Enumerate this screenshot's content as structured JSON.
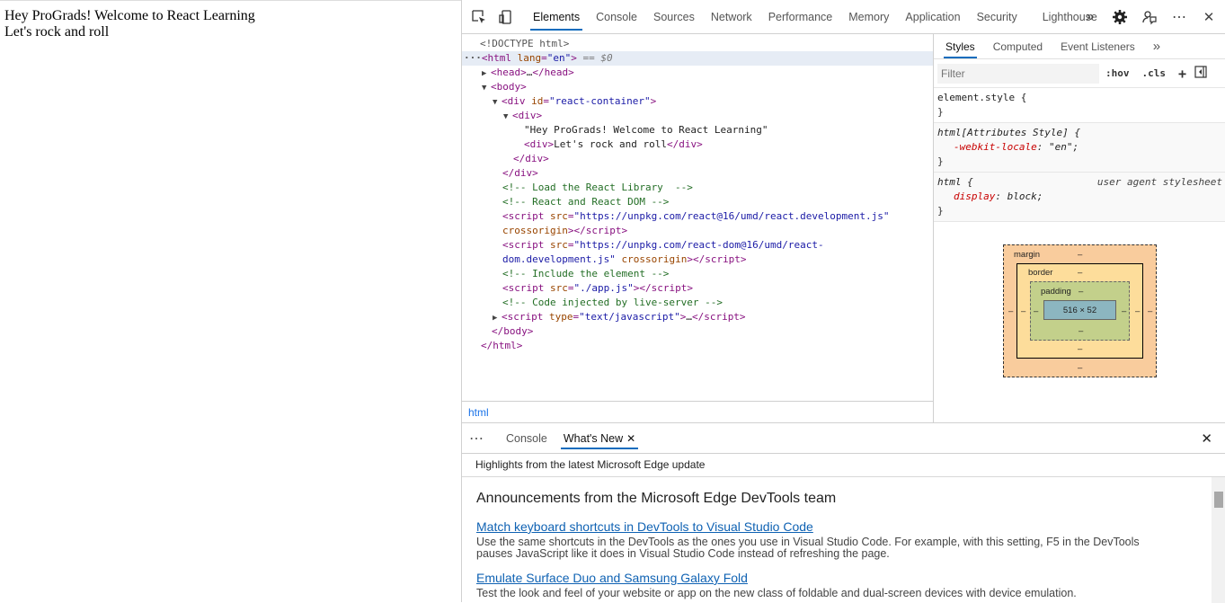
{
  "page": {
    "line1": "Hey ProGrads! Welcome to React Learning",
    "line2": "Let's rock and roll"
  },
  "devtools": {
    "tabs": [
      "Elements",
      "Console",
      "Sources",
      "Network",
      "Performance",
      "Memory",
      "Application",
      "Security",
      "Lighthouse"
    ],
    "active_tab": "Elements",
    "icons": {
      "inspect": "inspect-icon",
      "device": "device-toolbar-icon",
      "more_tabs": "»",
      "settings": "gear-icon",
      "feedback": "feedback-icon",
      "menu": "⋯",
      "close": "✕"
    }
  },
  "elements": {
    "doctype": "<!DOCTYPE html>",
    "html_lang_attr": "lang",
    "html_lang_val": "\"en\"",
    "selected_marker": "== $0",
    "head_collapsed": "…",
    "container_id": "\"react-container\"",
    "text_node": "\"Hey ProGrads! Welcome to React Learning\"",
    "inner_div_text": "Let's rock and roll",
    "comment1": "<!-- Load the React Library  -->",
    "comment2": "<!-- React and React DOM -->",
    "script1_src": "\"https://unpkg.com/react@16/umd/react.development.js\"",
    "script1_cont": "crossorigin",
    "script2_src": "\"https://unpkg.com/react-dom@16/umd/react-",
    "script2_src_cont": "dom.development.js\"",
    "script2_attr": "crossorigin",
    "comment3": "<!-- Include the element -->",
    "script3_src": "\"./app.js\"",
    "comment4": "<!-- Code injected by live-server -->",
    "script4_type": "\"text/javascript\"",
    "breadcrumb": "html"
  },
  "styles": {
    "tabs": [
      "Styles",
      "Computed",
      "Event Listeners"
    ],
    "more": "»",
    "filter_placeholder": "Filter",
    "hov": ":hov",
    "cls": ".cls",
    "plus": "+",
    "rule1_selector": "element.style {",
    "close_brace": "}",
    "rule2_selector": "html[Attributes Style] {",
    "rule2_prop": "-webkit-locale",
    "rule2_val": "\"en\";",
    "rule3_selector": "html {",
    "rule3_source": "user agent stylesheet",
    "rule3_prop": "display",
    "rule3_val": "block;"
  },
  "boxmodel": {
    "margin_label": "margin",
    "border_label": "border",
    "padding_label": "padding",
    "dash": "–",
    "content_size": "516 × 52"
  },
  "drawer": {
    "menu": "⋯",
    "tabs": [
      "Console",
      "What's New"
    ],
    "active_tab": "What's New",
    "close": "✕",
    "highlight_text": "Highlights from the latest Microsoft Edge update",
    "heading": "Announcements from the Microsoft Edge DevTools team",
    "items": [
      {
        "title": "Match keyboard shortcuts in DevTools to Visual Studio Code",
        "desc": "Use the same shortcuts in the DevTools as the ones you use in Visual Studio Code. For example, with this setting, F5 in the DevTools pauses JavaScript like it does in Visual Studio Code instead of refreshing the page."
      },
      {
        "title": "Emulate Surface Duo and Samsung Galaxy Fold",
        "desc": "Test the look and feel of your website or app on the new class of foldable and dual-screen devices with device emulation."
      }
    ]
  }
}
